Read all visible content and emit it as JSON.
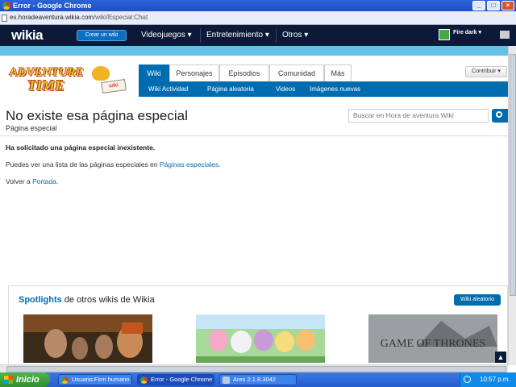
{
  "window": {
    "title": "Error - Google Chrome",
    "controls": [
      "_",
      "□",
      "×"
    ]
  },
  "addressbar": {
    "domain": "es.horadeaventura.wikia.com",
    "path": "/wiki/Especial:Chat"
  },
  "wikia_nav": {
    "logo": "wikia",
    "create_label": "Crear un wiki",
    "items": [
      {
        "label": "Videojuegos"
      },
      {
        "label": "Entretenimiento"
      },
      {
        "label": "Otros"
      }
    ],
    "username": "Fire dark"
  },
  "wiki": {
    "logo_line1": "ADVENTURE",
    "logo_line2": "TIME",
    "logo_tag": "wiki",
    "tabs": [
      {
        "label": "Wiki"
      },
      {
        "label": "Personajes"
      },
      {
        "label": "Episodios"
      },
      {
        "label": "Comunidad"
      },
      {
        "label": "Más"
      }
    ],
    "subtabs": [
      {
        "label": "Wiki Actividad"
      },
      {
        "label": "Página aleatoria"
      },
      {
        "label": "Videos"
      },
      {
        "label": "Imágenes nuevas"
      }
    ],
    "contribute_label": "Contribuir"
  },
  "page": {
    "title": "No existe esa página especial",
    "subtitle": "Página especial",
    "search_placeholder": "Buscar en Hora de aventura Wiki",
    "error": "Ha solicitado una página especial inexistente.",
    "list_prefix": "Puedes ver una lista de las páginas especiales en ",
    "list_link": "Páginas especiales",
    "list_suffix": ".",
    "back_prefix": "Volver a ",
    "back_link": "Portada",
    "back_suffix": "."
  },
  "spotlights": {
    "title_highlight": "Spotlights",
    "title_rest": " de otros wikis de Wikia",
    "random_label": "Wiki aleatorio",
    "thumb3_text": "GAME OF THRONES"
  },
  "taskbar": {
    "start_label": "Inicio",
    "tasks": [
      {
        "label": "Usuario:Finn humano ..."
      },
      {
        "label": "Error - Google Chrome"
      },
      {
        "label": "Ares 2.1.8.3042"
      }
    ],
    "clock": "10:57 p.m."
  }
}
